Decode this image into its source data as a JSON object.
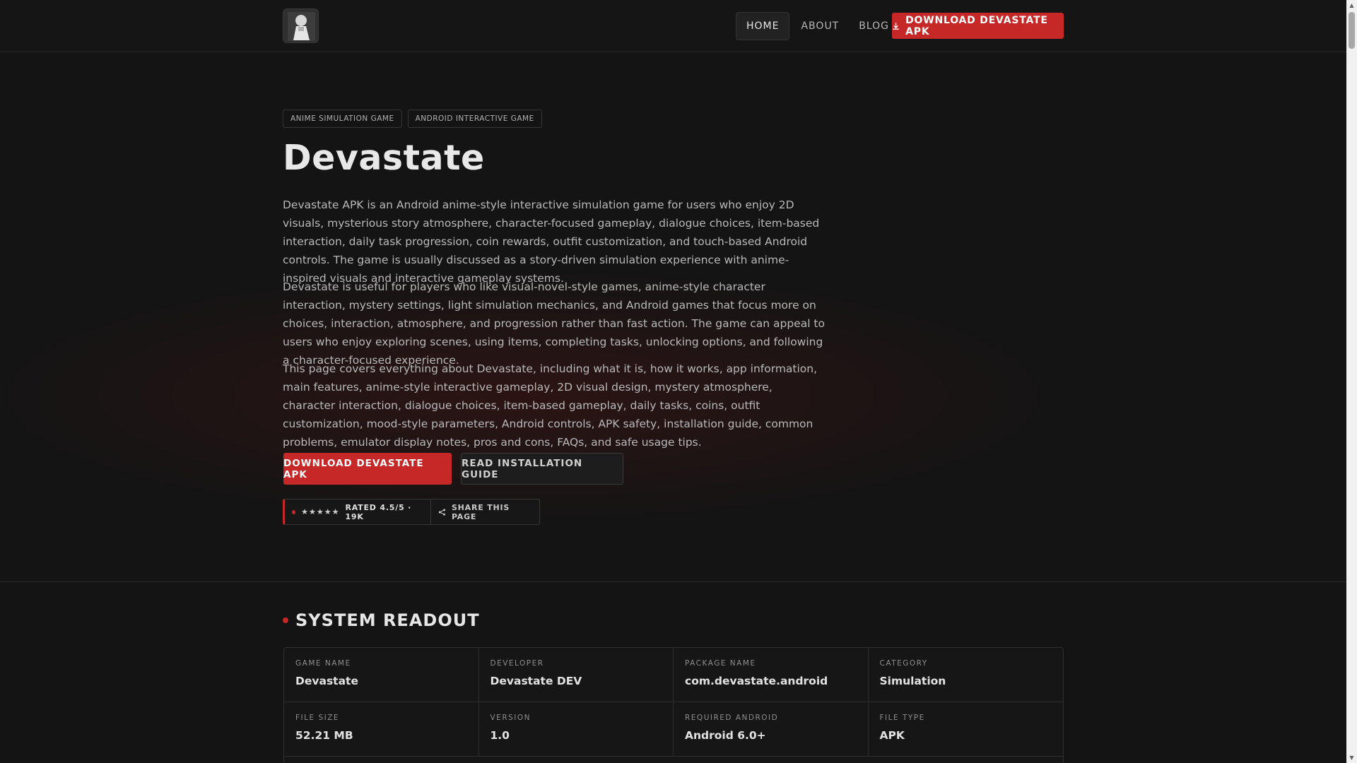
{
  "header": {
    "logo_alt": "Devastate logo",
    "nav": [
      {
        "label": "HOME",
        "active": true
      },
      {
        "label": "ABOUT",
        "active": false
      },
      {
        "label": "BLOG",
        "active": false
      }
    ],
    "download_label": "DOWNLOAD DEVASTATE APK",
    "download_icon": "download-icon"
  },
  "hero": {
    "tags": [
      "ANIME SIMULATION GAME",
      "ANDROID INTERACTIVE GAME"
    ],
    "title": "Devastate",
    "paragraphs": [
      "Devastate APK is an Android anime-style interactive simulation game for users who enjoy 2D visuals, mysterious story atmosphere, character-focused gameplay, dialogue choices, item-based interaction, daily task progression, coin rewards, outfit customization, and touch-based Android controls. The game is usually discussed as a story-driven simulation experience with anime-inspired visuals and interactive gameplay systems.",
      "Devastate is useful for players who like visual-novel-style games, anime-style character interaction, mystery settings, light simulation mechanics, and Android games that focus more on choices, interaction, atmosphere, and progression rather than fast action. The game can appeal to users who enjoy exploring scenes, using items, completing tasks, unlocking options, and following a character-focused experience.",
      "This page covers everything about Devastate, including what it is, how it works, app information, main features, anime-style interactive gameplay, 2D visual design, mystery atmosphere, character interaction, dialogue choices, item-based gameplay, daily tasks, coins, outfit customization, mood-style parameters, Android controls, APK safety, installation guide, common problems, emulator display notes, pros and cons, FAQs, and safe usage tips."
    ],
    "primary_button": "DOWNLOAD DEVASTATE APK",
    "secondary_button": "READ INSTALLATION GUIDE",
    "rating": {
      "stars": "★★★★★",
      "text": "RATED 4.5/5 · 19K",
      "share_label": "SHARE THIS PAGE",
      "share_icon": "share-icon"
    }
  },
  "readout": {
    "title": "SYSTEM READOUT",
    "cells": [
      {
        "label": "GAME NAME",
        "value": "Devastate"
      },
      {
        "label": "DEVELOPER",
        "value": "Devastate DEV"
      },
      {
        "label": "PACKAGE NAME",
        "value": "com.devastate.android"
      },
      {
        "label": "CATEGORY",
        "value": "Simulation"
      },
      {
        "label": "FILE SIZE",
        "value": "52.21 MB"
      },
      {
        "label": "VERSION",
        "value": "1.0"
      },
      {
        "label": "REQUIRED ANDROID",
        "value": "Android 6.0+"
      },
      {
        "label": "FILE TYPE",
        "value": "APK"
      }
    ]
  },
  "colors": {
    "accent": "#c62828",
    "background": "#141414"
  }
}
